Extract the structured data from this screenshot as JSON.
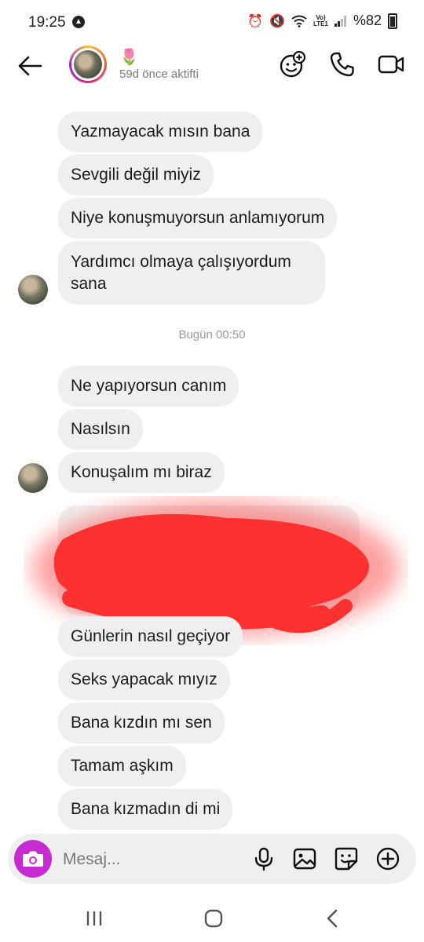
{
  "status_bar": {
    "time": "19:25",
    "battery": "%82"
  },
  "header": {
    "emoji": "🌷",
    "status": "59d önce aktifti"
  },
  "messages_group1": [
    {
      "text": "Yazmayacak mısın bana"
    },
    {
      "text": "Sevgili değil miyiz"
    },
    {
      "text": "Niye konuşmuyorsun anlamıyorum"
    },
    {
      "text": "Yardımcı olmaya çalışıyordum sana"
    }
  ],
  "timestamp": "Bugün 00:50",
  "messages_group2": [
    {
      "text": "Ne yapıyorsun canım"
    },
    {
      "text": "Nasılsın"
    },
    {
      "text": "Konuşalım mı biraz"
    }
  ],
  "messages_group3": [
    {
      "text": "Günlerin nasıl geçiyor"
    },
    {
      "text": "Seks yapacak mıyız"
    },
    {
      "text": "Bana kızdın mı sen"
    },
    {
      "text": "Tamam aşkım"
    },
    {
      "text": "Bana kızmadın di mi"
    }
  ],
  "composer": {
    "placeholder": "Mesaj..."
  },
  "colors": {
    "bubble_bg": "#efefef",
    "camera_button": "#c72ad1",
    "redaction": "#ff2d2d"
  }
}
